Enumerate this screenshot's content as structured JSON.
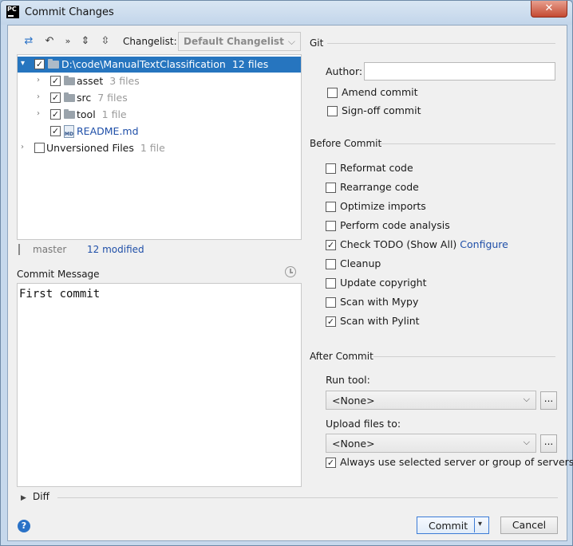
{
  "window": {
    "title": "Commit Changes",
    "close_label": "✕",
    "app_icon_text": "PC"
  },
  "toolbar": {
    "changelist_label": "Changelist:",
    "changelist_value": "Default Changelist"
  },
  "tree": {
    "root": {
      "label": "D:\\code\\ManualTextClassification",
      "count": "12 files",
      "checked": true
    },
    "children": [
      {
        "label": "asset",
        "count": "3 files",
        "checked": true
      },
      {
        "label": "src",
        "count": "7 files",
        "checked": true
      },
      {
        "label": "tool",
        "count": "1 file",
        "checked": true
      }
    ],
    "readme": {
      "label": "README.md",
      "checked": true
    },
    "unversioned": {
      "label": "Unversioned Files",
      "count": "1 file",
      "checked": false
    }
  },
  "status": {
    "branch": "master",
    "modified": "12 modified"
  },
  "commit_message": {
    "label": "Commit Message",
    "value": "First commit"
  },
  "git": {
    "title": "Git",
    "author_label": "Author:",
    "author_value": "",
    "amend_label": "Amend commit",
    "signoff_label": "Sign-off commit"
  },
  "before_commit": {
    "title": "Before Commit",
    "items": [
      {
        "label": "Reformat code",
        "checked": false
      },
      {
        "label": "Rearrange code",
        "checked": false
      },
      {
        "label": "Optimize imports",
        "checked": false
      },
      {
        "label": "Perform code analysis",
        "checked": false
      },
      {
        "label": "Check TODO (Show All)",
        "checked": true,
        "link": "Configure"
      },
      {
        "label": "Cleanup",
        "checked": false
      },
      {
        "label": "Update copyright",
        "checked": false
      },
      {
        "label": "Scan with Mypy",
        "checked": false
      },
      {
        "label": "Scan with Pylint",
        "checked": true
      }
    ]
  },
  "after_commit": {
    "title": "After Commit",
    "run_tool_label": "Run tool:",
    "run_tool_value": "<None>",
    "upload_label": "Upload files to:",
    "upload_value": "<None>",
    "dots": "...",
    "always_use_label": "Always use selected server or group of servers",
    "always_use_checked": true
  },
  "diff": {
    "label": "Diff"
  },
  "buttons": {
    "help": "?",
    "commit": "Commit",
    "cancel": "Cancel"
  }
}
